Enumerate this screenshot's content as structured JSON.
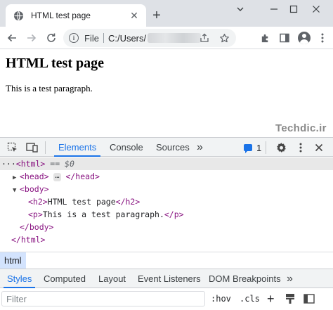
{
  "browser": {
    "tab_title": "HTML test page",
    "tab_close_glyph": "✕",
    "new_tab_glyph": "+",
    "address": {
      "scheme_label": "File",
      "path_visible": "C:/Users/"
    }
  },
  "page": {
    "heading": "HTML test page",
    "paragraph": "This is a test paragraph.",
    "watermark": "Techdic.ir"
  },
  "devtools": {
    "tabs": [
      "Elements",
      "Console",
      "Sources"
    ],
    "more_tabs_glyph": "»",
    "messages_count": "1",
    "tree": {
      "html_open": "<html>",
      "selected_marker": "== $0",
      "head_open": "<head>",
      "head_ellipsis": "…",
      "head_close": "</head>",
      "body_open": "<body>",
      "h2_open": "<h2>",
      "h2_text": "HTML test page",
      "h2_close": "</h2>",
      "p_open": "<p>",
      "p_text": "This is a test paragraph.",
      "p_close": "</p>",
      "body_close": "</body>",
      "html_close": "</html>",
      "leading_dots": "···"
    },
    "breadcrumb": "html",
    "styles_tabs": [
      "Styles",
      "Computed",
      "Layout",
      "Event Listeners",
      "DOM Breakpoints"
    ],
    "styles_more_glyph": "»",
    "filter_placeholder": "Filter",
    "hov_label": ":hov",
    "cls_label": ".cls",
    "plus_label": "+"
  },
  "colors": {
    "accent": "#1a73e8",
    "tag": "#881280",
    "tabstrip": "#dee1e6",
    "breadcrumb_bg": "#d3e3fd"
  }
}
